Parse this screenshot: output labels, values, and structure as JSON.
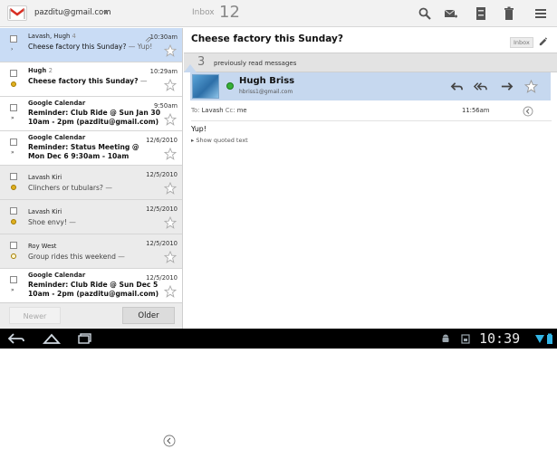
{
  "topbar": {
    "account": "pazditu@gmail.com",
    "inbox_label": "Inbox",
    "inbox_count": "12"
  },
  "list": {
    "rows": [
      {
        "sender": "Lavash, Hugh",
        "count": "4",
        "subject": "Cheese factory this Sunday?",
        "snippet": " — Yup!",
        "time": "10:30am"
      },
      {
        "sender": "Hugh",
        "count": "2",
        "subject": "Cheese factory this Sunday?",
        "snippet": " —",
        "time": "10:29am"
      },
      {
        "sender": "Google Calendar",
        "subject": "Reminder: Club Ride @ Sun Jan 30",
        "subject2": "10am - 2pm (pazditu@gmail.com)",
        "time": "9:50am"
      },
      {
        "sender": "Google Calendar",
        "subject": "Reminder: Status Meeting @",
        "subject2": "Mon Dec 6 9:30am - 10am",
        "time": "12/6/2010"
      },
      {
        "sender": "Lavash Kiri",
        "subject": "Clinchers or tubulars?",
        "snippet": " —",
        "time": "12/5/2010"
      },
      {
        "sender": "Lavash Kiri",
        "subject": "Shoe envy!",
        "snippet": " —",
        "time": "12/5/2010"
      },
      {
        "sender": "Roy West",
        "subject": "Group rides this weekend",
        "snippet": " —",
        "time": "12/5/2010"
      },
      {
        "sender": "Google Calendar",
        "subject": "Reminder: Club Ride @ Sun Dec 5",
        "subject2": "10am - 2pm (pazditu@gmail.com)",
        "time": "12/5/2010"
      }
    ],
    "newer_label": "Newer",
    "older_label": "Older"
  },
  "pane": {
    "subject": "Cheese factory this Sunday?",
    "inbox_tag": "Inbox",
    "prev_count": "3",
    "prev_text": "previously read messages",
    "from_name": "Hugh Briss",
    "from_email": "hbriss1@gmail.com",
    "to_label": "To:",
    "to_value": "Lavash",
    "cc_label": "Cc:",
    "cc_value": "me",
    "time": "11:56am",
    "body": "Yup!",
    "quoted": "▸ Show quoted text"
  },
  "sysbar": {
    "clock": "10:39"
  },
  "colors": {
    "selected_row": "#c9dcf5",
    "header_band": "#c6d8ef",
    "presence": "#36b036"
  }
}
